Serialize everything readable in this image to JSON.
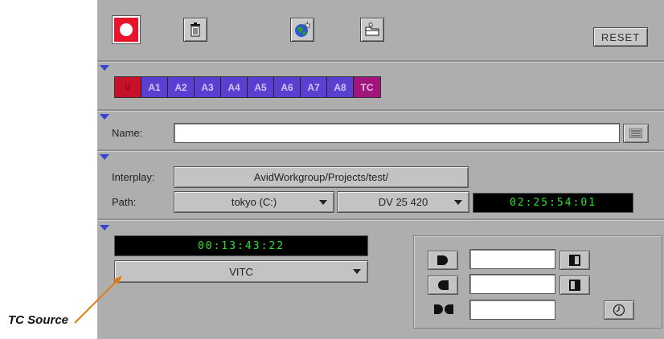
{
  "toolbar": {
    "record_icon": "record-icon",
    "trash_icon": "trash-icon",
    "globe_icon": "globe-icon",
    "folder_icon": "folder-icon",
    "reset_label": "RESET"
  },
  "tracks": {
    "items": [
      {
        "label": "V",
        "kind": "v"
      },
      {
        "label": "A1",
        "kind": "a"
      },
      {
        "label": "A2",
        "kind": "a"
      },
      {
        "label": "A3",
        "kind": "a"
      },
      {
        "label": "A4",
        "kind": "a"
      },
      {
        "label": "A5",
        "kind": "a"
      },
      {
        "label": "A6",
        "kind": "a"
      },
      {
        "label": "A7",
        "kind": "a"
      },
      {
        "label": "A8",
        "kind": "a"
      },
      {
        "label": "TC",
        "kind": "tc"
      }
    ],
    "colors": {
      "video": "#c9102a",
      "audio": "#5b3fd0",
      "tc": "#a1167c"
    }
  },
  "name_section": {
    "label": "Name:",
    "value": ""
  },
  "target_section": {
    "interplay_label": "Interplay:",
    "interplay_value": "AvidWorkgroup/Projects/test/",
    "path_label": "Path:",
    "drive_value": "tokyo (C:)",
    "resolution_value": "DV 25 420",
    "remaining_time": "02:25:54:01"
  },
  "timecode_section": {
    "timecode": "00:13:43:22",
    "tc_source_value": "VITC",
    "mark_in_value": "",
    "mark_out_value": "",
    "duration_value": ""
  },
  "annotation": {
    "label": "TC Source",
    "color": "#e07b12"
  },
  "colors": {
    "lcd_text": "#2de02d",
    "panel": "#aeaeae"
  }
}
